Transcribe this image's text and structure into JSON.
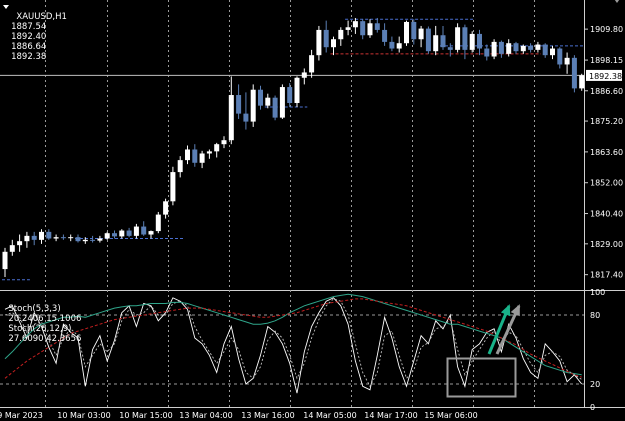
{
  "header": {
    "symbol": "XAUUSD,H1",
    "open": "1887.54",
    "high": "1892.40",
    "low": "1886.64",
    "close": "1892.38"
  },
  "indicator": {
    "stoch1_name": "Stoch(5,3,3)",
    "stoch1_values": "20.2406 15.1006",
    "stoch2_name": "Stoch(26,12,9)",
    "stoch2_values": "27.6090 42.3656"
  },
  "colors": {
    "background": "#000000",
    "bull": "#ffffff",
    "bear": "#5b7fb5",
    "grid": "#9a9a9a",
    "support_line": "#4a6fd0",
    "resistance_line": "#cc3333",
    "stoch_fast_main": "#ffffff",
    "stoch_slow_main": "#2fa58a",
    "stoch_slow_signal": "#c01f1f",
    "arrow_green": "#19b38a",
    "arrow_gray": "#9a9a9a"
  },
  "chart_data": [
    {
      "type": "candlestick",
      "title": "XAUUSD,H1",
      "y_ticks": [
        "1909.80",
        "1898.15",
        "1886.60",
        "1875.20",
        "1863.60",
        "1852.00",
        "1840.40",
        "1829.00",
        "1817.40"
      ],
      "current_price_label": "1892.38",
      "ylim": [
        1812,
        1917
      ],
      "x_tick_labels": [
        "9 Mar 2023",
        "10 Mar 03:00",
        "10 Mar 15:00",
        "13 Mar 04:00",
        "13 Mar 16:00",
        "14 Mar 05:00",
        "14 Mar 17:00",
        "15 Mar 06:00"
      ],
      "candles": [
        {
          "o": 1819.5,
          "h": 1827.5,
          "l": 1816.5,
          "c": 1826.0
        },
        {
          "o": 1826.0,
          "h": 1830.5,
          "l": 1824.5,
          "c": 1828.5
        },
        {
          "o": 1828.5,
          "h": 1832.5,
          "l": 1826.0,
          "c": 1830.0
        },
        {
          "o": 1830.0,
          "h": 1833.5,
          "l": 1827.5,
          "c": 1832.0
        },
        {
          "o": 1832.0,
          "h": 1833.5,
          "l": 1828.5,
          "c": 1830.5
        },
        {
          "o": 1830.5,
          "h": 1834.5,
          "l": 1829.0,
          "c": 1833.5
        },
        {
          "o": 1833.5,
          "h": 1834.5,
          "l": 1830.5,
          "c": 1831.0
        },
        {
          "o": 1831.0,
          "h": 1832.5,
          "l": 1830.0,
          "c": 1831.5
        },
        {
          "o": 1831.5,
          "h": 1832.5,
          "l": 1830.5,
          "c": 1831.2
        },
        {
          "o": 1831.2,
          "h": 1832.5,
          "l": 1830.0,
          "c": 1831.5
        },
        {
          "o": 1831.5,
          "h": 1832.5,
          "l": 1829.5,
          "c": 1830.0
        },
        {
          "o": 1830.0,
          "h": 1831.5,
          "l": 1829.0,
          "c": 1830.5
        },
        {
          "o": 1830.5,
          "h": 1832.0,
          "l": 1829.5,
          "c": 1830.2
        },
        {
          "o": 1830.2,
          "h": 1832.0,
          "l": 1829.5,
          "c": 1831.0
        },
        {
          "o": 1831.0,
          "h": 1833.5,
          "l": 1830.5,
          "c": 1833.0
        },
        {
          "o": 1833.0,
          "h": 1834.0,
          "l": 1831.0,
          "c": 1831.8
        },
        {
          "o": 1831.8,
          "h": 1834.5,
          "l": 1831.0,
          "c": 1834.0
        },
        {
          "o": 1834.0,
          "h": 1835.0,
          "l": 1831.5,
          "c": 1832.0
        },
        {
          "o": 1832.0,
          "h": 1836.5,
          "l": 1831.0,
          "c": 1835.5
        },
        {
          "o": 1835.5,
          "h": 1837.5,
          "l": 1832.0,
          "c": 1832.5
        },
        {
          "o": 1832.5,
          "h": 1834.0,
          "l": 1831.0,
          "c": 1833.8
        },
        {
          "o": 1833.8,
          "h": 1841.0,
          "l": 1833.0,
          "c": 1840.0
        },
        {
          "o": 1840.0,
          "h": 1846.0,
          "l": 1838.5,
          "c": 1845.0
        },
        {
          "o": 1845.0,
          "h": 1858.0,
          "l": 1843.5,
          "c": 1856.0
        },
        {
          "o": 1856.0,
          "h": 1862.0,
          "l": 1854.0,
          "c": 1860.5
        },
        {
          "o": 1860.5,
          "h": 1866.0,
          "l": 1859.0,
          "c": 1864.5
        },
        {
          "o": 1864.5,
          "h": 1866.5,
          "l": 1858.0,
          "c": 1859.5
        },
        {
          "o": 1859.5,
          "h": 1864.0,
          "l": 1857.5,
          "c": 1863.0
        },
        {
          "o": 1863.0,
          "h": 1864.5,
          "l": 1861.0,
          "c": 1863.8
        },
        {
          "o": 1863.8,
          "h": 1867.0,
          "l": 1861.5,
          "c": 1866.5
        },
        {
          "o": 1866.5,
          "h": 1869.5,
          "l": 1865.0,
          "c": 1868.0
        },
        {
          "o": 1868.0,
          "h": 1892.0,
          "l": 1866.5,
          "c": 1885.0
        },
        {
          "o": 1885.0,
          "h": 1889.0,
          "l": 1876.0,
          "c": 1878.0
        },
        {
          "o": 1878.0,
          "h": 1886.0,
          "l": 1872.0,
          "c": 1875.0
        },
        {
          "o": 1875.0,
          "h": 1889.0,
          "l": 1873.0,
          "c": 1887.0
        },
        {
          "o": 1887.0,
          "h": 1888.5,
          "l": 1879.5,
          "c": 1881.0
        },
        {
          "o": 1881.0,
          "h": 1885.5,
          "l": 1880.0,
          "c": 1884.0
        },
        {
          "o": 1884.0,
          "h": 1884.8,
          "l": 1875.5,
          "c": 1876.5
        },
        {
          "o": 1876.5,
          "h": 1889.0,
          "l": 1876.0,
          "c": 1888.0
        },
        {
          "o": 1888.0,
          "h": 1889.5,
          "l": 1880.5,
          "c": 1882.0
        },
        {
          "o": 1882.0,
          "h": 1892.0,
          "l": 1880.5,
          "c": 1891.5
        },
        {
          "o": 1891.5,
          "h": 1895.0,
          "l": 1889.0,
          "c": 1893.5
        },
        {
          "o": 1893.5,
          "h": 1902.0,
          "l": 1891.5,
          "c": 1900.0
        },
        {
          "o": 1900.0,
          "h": 1911.0,
          "l": 1898.0,
          "c": 1909.5
        },
        {
          "o": 1909.5,
          "h": 1913.0,
          "l": 1901.0,
          "c": 1903.0
        },
        {
          "o": 1903.0,
          "h": 1907.0,
          "l": 1900.0,
          "c": 1906.0
        },
        {
          "o": 1906.0,
          "h": 1910.5,
          "l": 1903.5,
          "c": 1909.5
        },
        {
          "o": 1909.5,
          "h": 1913.0,
          "l": 1907.5,
          "c": 1910.5
        },
        {
          "o": 1910.5,
          "h": 1914.0,
          "l": 1908.0,
          "c": 1912.8
        },
        {
          "o": 1912.8,
          "h": 1913.5,
          "l": 1906.0,
          "c": 1907.5
        },
        {
          "o": 1907.5,
          "h": 1913.5,
          "l": 1906.5,
          "c": 1912.0
        },
        {
          "o": 1912.0,
          "h": 1914.0,
          "l": 1908.5,
          "c": 1909.5
        },
        {
          "o": 1909.5,
          "h": 1912.0,
          "l": 1903.5,
          "c": 1905.0
        },
        {
          "o": 1905.0,
          "h": 1907.0,
          "l": 1901.5,
          "c": 1902.5
        },
        {
          "o": 1902.5,
          "h": 1907.0,
          "l": 1901.0,
          "c": 1904.5
        },
        {
          "o": 1904.5,
          "h": 1913.0,
          "l": 1903.5,
          "c": 1912.5
        },
        {
          "o": 1912.5,
          "h": 1913.5,
          "l": 1904.0,
          "c": 1906.0
        },
        {
          "o": 1906.0,
          "h": 1911.0,
          "l": 1903.0,
          "c": 1910.0
        },
        {
          "o": 1910.0,
          "h": 1910.8,
          "l": 1900.5,
          "c": 1901.5
        },
        {
          "o": 1901.5,
          "h": 1911.0,
          "l": 1900.0,
          "c": 1907.5
        },
        {
          "o": 1907.5,
          "h": 1911.0,
          "l": 1902.0,
          "c": 1903.0
        },
        {
          "o": 1903.0,
          "h": 1904.5,
          "l": 1899.5,
          "c": 1902.0
        },
        {
          "o": 1902.0,
          "h": 1912.0,
          "l": 1901.0,
          "c": 1910.5
        },
        {
          "o": 1910.5,
          "h": 1911.5,
          "l": 1898.5,
          "c": 1902.0
        },
        {
          "o": 1902.0,
          "h": 1909.0,
          "l": 1901.0,
          "c": 1908.0
        },
        {
          "o": 1908.0,
          "h": 1909.5,
          "l": 1900.0,
          "c": 1902.5
        },
        {
          "o": 1902.5,
          "h": 1904.0,
          "l": 1898.0,
          "c": 1899.5
        },
        {
          "o": 1899.5,
          "h": 1906.0,
          "l": 1898.5,
          "c": 1905.0
        },
        {
          "o": 1905.0,
          "h": 1905.5,
          "l": 1899.0,
          "c": 1900.5
        },
        {
          "o": 1900.5,
          "h": 1906.0,
          "l": 1899.5,
          "c": 1904.5
        },
        {
          "o": 1904.5,
          "h": 1905.0,
          "l": 1900.5,
          "c": 1901.5
        },
        {
          "o": 1901.5,
          "h": 1904.0,
          "l": 1900.5,
          "c": 1903.5
        },
        {
          "o": 1903.5,
          "h": 1904.5,
          "l": 1901.0,
          "c": 1902.0
        },
        {
          "o": 1902.0,
          "h": 1905.0,
          "l": 1901.0,
          "c": 1904.0
        },
        {
          "o": 1904.0,
          "h": 1904.5,
          "l": 1899.0,
          "c": 1900.0
        },
        {
          "o": 1900.0,
          "h": 1903.5,
          "l": 1898.5,
          "c": 1902.5
        },
        {
          "o": 1902.5,
          "h": 1903.0,
          "l": 1895.0,
          "c": 1896.5
        },
        {
          "o": 1896.5,
          "h": 1901.0,
          "l": 1893.0,
          "c": 1899.0
        },
        {
          "o": 1899.0,
          "h": 1900.0,
          "l": 1886.0,
          "c": 1887.5
        },
        {
          "o": 1887.5,
          "h": 1893.0,
          "l": 1886.6,
          "c": 1892.4
        }
      ],
      "levels": [
        {
          "price": 1815.5,
          "from": 0,
          "to": 3,
          "style": "support"
        },
        {
          "price": 1831.0,
          "from": 10,
          "to": 24,
          "style": "support"
        },
        {
          "price": 1880.5,
          "from": 36,
          "to": 41,
          "style": "support"
        },
        {
          "price": 1913.5,
          "from": 47,
          "to": 64,
          "style": "support"
        },
        {
          "price": 1900.5,
          "from": 45,
          "to": 73,
          "style": "resistance"
        },
        {
          "price": 1903.5,
          "from": 60,
          "to": 79,
          "style": "support"
        }
      ]
    },
    {
      "type": "line",
      "title": "Stoch(5,3,3) / Stoch(26,12,9)",
      "ylim": [
        0,
        100
      ],
      "y_ticks": [
        "100",
        "80",
        "20",
        "0"
      ],
      "levels": [
        80,
        20
      ],
      "series": [
        {
          "name": "Stoch(5,3,3)",
          "values": [
            85,
            88,
            74,
            60,
            82,
            70,
            52,
            38,
            72,
            65,
            60,
            18,
            50,
            62,
            40,
            58,
            82,
            88,
            70,
            90,
            88,
            75,
            82,
            95,
            92,
            85,
            60,
            55,
            45,
            30,
            55,
            70,
            42,
            20,
            25,
            45,
            70,
            65,
            55,
            38,
            12,
            48,
            70,
            82,
            92,
            95,
            88,
            72,
            40,
            18,
            15,
            45,
            78,
            60,
            35,
            18,
            40,
            62,
            55,
            75,
            68,
            80,
            35,
            18,
            50,
            55,
            65,
            68,
            48,
            72,
            60,
            42,
            30,
            25,
            55,
            48,
            40,
            22,
            28,
            20
          ]
        },
        {
          "name": "Stoch(5,3,3) signal",
          "values": [
            80,
            82,
            78,
            65,
            72,
            74,
            58,
            45,
            60,
            68,
            62,
            35,
            45,
            55,
            48,
            55,
            75,
            85,
            80,
            82,
            88,
            80,
            80,
            90,
            92,
            88,
            70,
            58,
            48,
            38,
            48,
            60,
            50,
            30,
            25,
            35,
            58,
            66,
            60,
            45,
            25,
            38,
            60,
            76,
            88,
            94,
            92,
            80,
            55,
            30,
            18,
            30,
            62,
            66,
            45,
            25,
            32,
            52,
            56,
            68,
            70,
            76,
            50,
            28,
            40,
            50,
            60,
            66,
            55,
            65,
            62,
            50,
            38,
            30,
            45,
            48,
            44,
            32,
            28,
            24
          ]
        },
        {
          "name": "Stoch(26,12,9)",
          "values": [
            42,
            48,
            55,
            62,
            68,
            72,
            74,
            76,
            78,
            78,
            79,
            78,
            80,
            82,
            84,
            86,
            87,
            88,
            88,
            89,
            90,
            90,
            90,
            91,
            91,
            90,
            88,
            86,
            84,
            82,
            80,
            78,
            76,
            74,
            72,
            72,
            73,
            75,
            78,
            82,
            85,
            88,
            90,
            92,
            94,
            96,
            97,
            98,
            97,
            96,
            94,
            92,
            90,
            88,
            86,
            84,
            82,
            80,
            78,
            76,
            74,
            72,
            72,
            70,
            68,
            66,
            64,
            62,
            60,
            56,
            52,
            48,
            44,
            40,
            36,
            34,
            32,
            30,
            29,
            28
          ]
        },
        {
          "name": "Stoch(26,12,9) signal",
          "values": [
            25,
            30,
            35,
            40,
            44,
            48,
            52,
            56,
            60,
            64,
            66,
            68,
            70,
            72,
            74,
            76,
            77,
            78,
            79,
            80,
            81,
            82,
            83,
            84,
            85,
            86,
            86,
            86,
            85,
            84,
            83,
            82,
            81,
            80,
            79,
            78,
            78,
            79,
            80,
            81,
            82,
            84,
            86,
            88,
            90,
            91,
            92,
            93,
            94,
            94,
            93,
            92,
            91,
            90,
            89,
            88,
            86,
            84,
            82,
            80,
            78,
            76,
            74,
            72,
            70,
            68,
            66,
            63,
            60,
            57,
            54,
            50,
            46,
            43,
            40,
            37,
            34,
            31,
            28,
            26
          ]
        }
      ]
    }
  ]
}
